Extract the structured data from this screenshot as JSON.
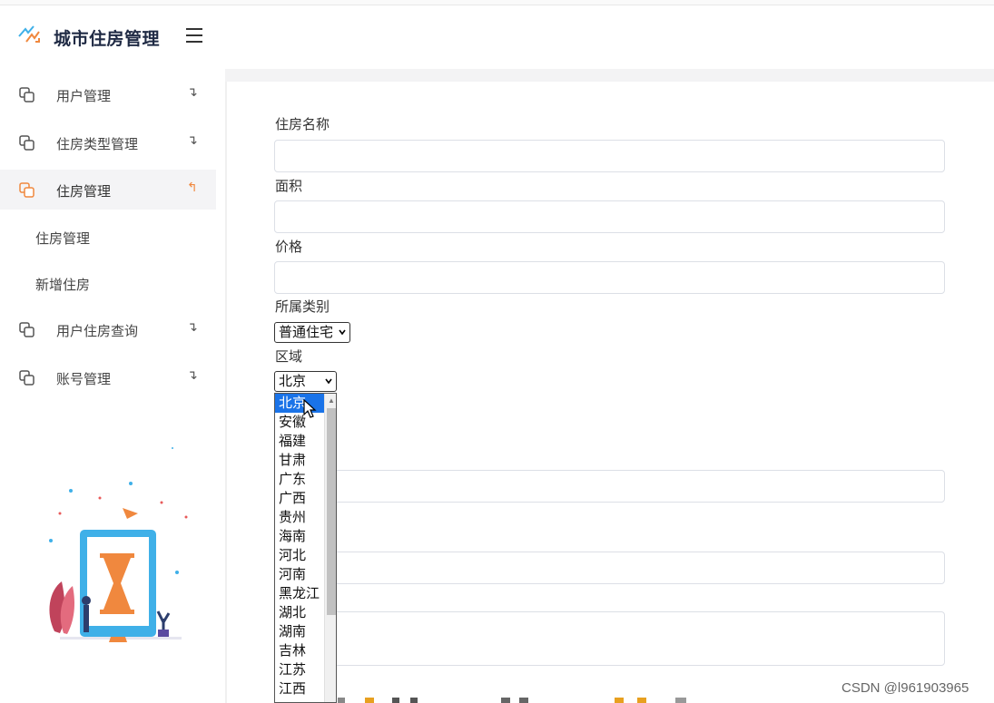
{
  "app": {
    "title": "城市住房管理"
  },
  "sidebar": {
    "items": [
      {
        "label": "用户管理",
        "chevron": "↴"
      },
      {
        "label": "住房类型管理",
        "chevron": "↴"
      },
      {
        "label": "住房管理",
        "chevron": "↰"
      },
      {
        "label": "用户住房查询",
        "chevron": "↴"
      },
      {
        "label": "账号管理",
        "chevron": "↴"
      }
    ],
    "sub_items": [
      {
        "label": "住房管理"
      },
      {
        "label": "新增住房"
      }
    ]
  },
  "form": {
    "name_label": "住房名称",
    "area_label": "面积",
    "price_label": "价格",
    "category_label": "所属类别",
    "category_value": "普通住宅",
    "region_label": "区域",
    "region_value": "北京"
  },
  "region_options": [
    "北京",
    "安徽",
    "福建",
    "甘肃",
    "广东",
    "广西",
    "贵州",
    "海南",
    "河北",
    "河南",
    "黑龙江",
    "湖北",
    "湖南",
    "吉林",
    "江苏",
    "江西"
  ],
  "watermark": "CSDN @l961903965",
  "colors": {
    "accent": "#f0883e",
    "selected": "#1a73e8",
    "illustration_blue": "#3fb0e8"
  },
  "icons": [
    "logo-icon",
    "menu-icon",
    "copy-icon",
    "chevron-down-icon",
    "chevron-up-icon",
    "cursor-icon"
  ]
}
